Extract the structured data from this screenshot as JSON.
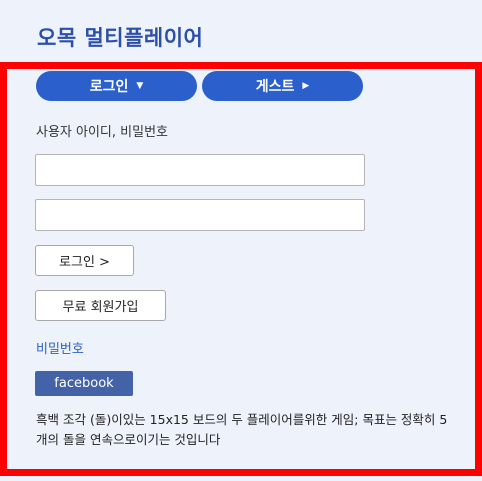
{
  "header": {
    "title": "오목 멀티플레이어"
  },
  "tabs": {
    "login_label": "로그인",
    "login_arrow": "▼",
    "guest_label": "게스트",
    "guest_arrow": "▶"
  },
  "form": {
    "field_label": "사용자 아이디, 비밀번호",
    "username_value": "",
    "password_value": "",
    "login_button": "로그인 >",
    "signup_button": "무료 회원가입",
    "password_link": "비밀번호",
    "facebook_button": "facebook"
  },
  "description": "흑백 조각 (돌)이있는 15x15 보드의 두 플레이어를위한 게임; 목표는 정확히 5 개의 돌을 연속으로이기는 것입니다",
  "colors": {
    "accent": "#2a5fcc",
    "title": "#2c4fa8",
    "facebook": "#4462a8",
    "highlight_frame": "#ff0000",
    "panel_background": "#eef3fb"
  }
}
